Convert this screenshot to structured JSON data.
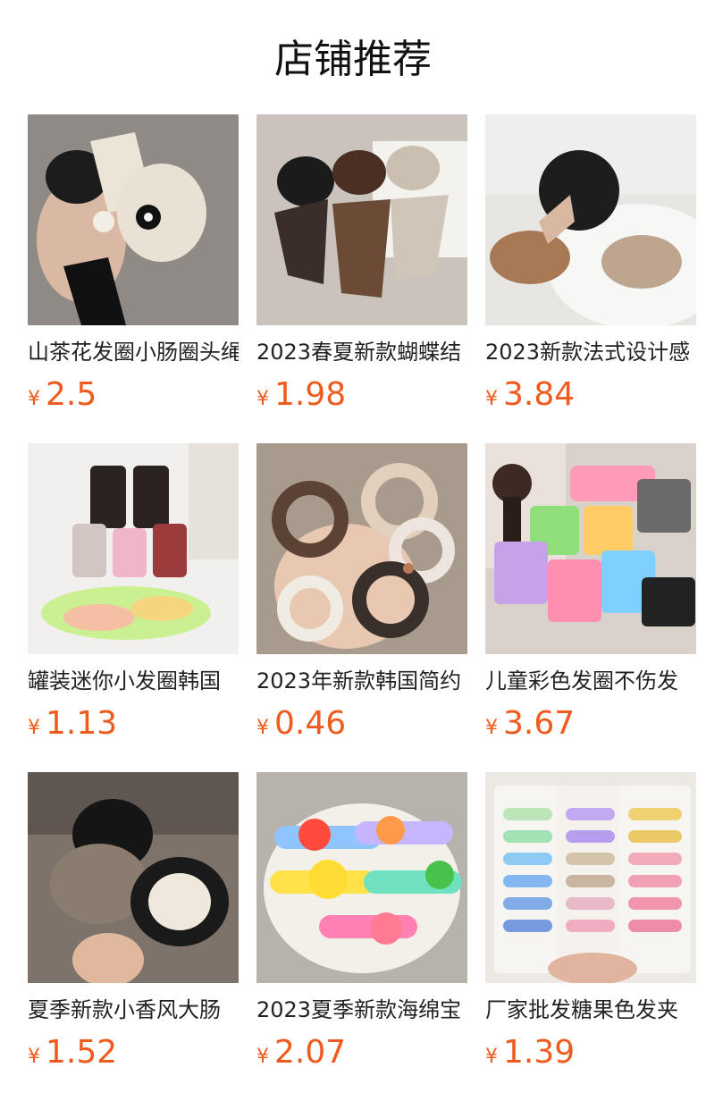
{
  "section": {
    "title": "店铺推荐"
  },
  "products": [
    {
      "name": "山茶花发圈小肠圈头绳",
      "currency": "¥",
      "price": "2.5",
      "image": "scrunchie-bow-camellia-photo",
      "bg": "#8f8a86"
    },
    {
      "name": "2023春夏新款蝴蝶结",
      "currency": "¥",
      "price": "1.98",
      "image": "bow-scrunchies-set-photo",
      "bg": "#c9c3bb"
    },
    {
      "name": "2023新款法式设计感",
      "currency": "¥",
      "price": "3.84",
      "image": "satin-scrunchies-photo",
      "bg": "#e8e6e3"
    },
    {
      "name": "罐装迷你小发圈韩国",
      "currency": "¥",
      "price": "1.13",
      "image": "jar-mini-hair-ties-photo",
      "bg": "#f2f0ee"
    },
    {
      "name": "2023年新款韩国简约",
      "currency": "¥",
      "price": "0.46",
      "image": "heart-scrunchies-photo",
      "bg": "#a89a8c"
    },
    {
      "name": "儿童彩色发圈不伤发",
      "currency": "¥",
      "price": "3.67",
      "image": "kids-color-hair-ties-photo",
      "bg": "#d8d2cb"
    },
    {
      "name": "夏季新款小香风大肠",
      "currency": "¥",
      "price": "1.52",
      "image": "large-satin-scrunchies-photo",
      "bg": "#7d736b"
    },
    {
      "name": "2023夏季新款海绵宝",
      "currency": "¥",
      "price": "2.07",
      "image": "cartoon-hair-clips-photo",
      "bg": "#b8b2ad"
    },
    {
      "name": "厂家批发糖果色发夹",
      "currency": "¥",
      "price": "1.39",
      "image": "candy-color-hair-clips-photo",
      "bg": "#ece9e5"
    }
  ]
}
